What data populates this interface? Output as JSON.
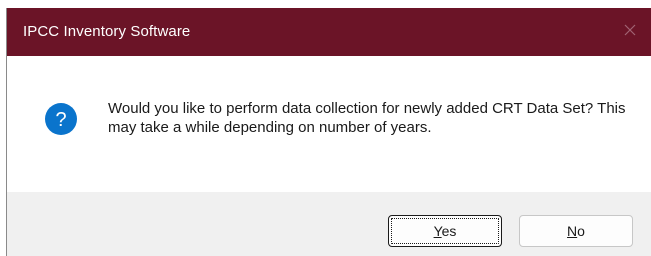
{
  "dialog": {
    "title": "IPCC Inventory Software",
    "message": "Would you like to perform data collection for newly added CRT Data Set? This may take a while depending on number of years.",
    "icon": "question-icon",
    "buttons": [
      {
        "label": "Yes",
        "mnemonic": "Y",
        "rest": "es",
        "focused": true
      },
      {
        "label": "No",
        "mnemonic": "N",
        "rest": "o",
        "focused": false
      }
    ]
  },
  "colors": {
    "titlebar": "#6b1427",
    "question_icon": "#0a74cc",
    "footer": "#f0f0f0"
  }
}
